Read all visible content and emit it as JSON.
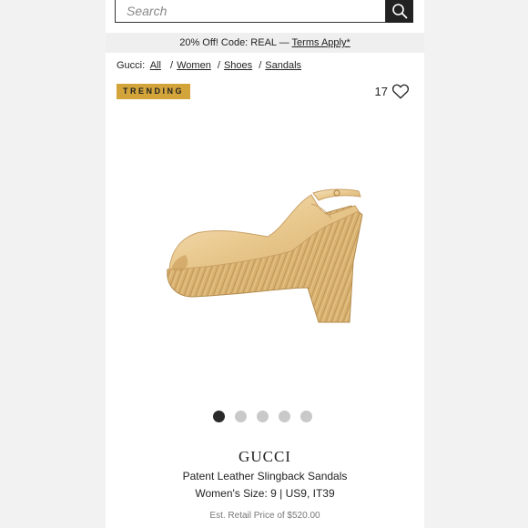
{
  "search": {
    "placeholder": "Search",
    "icon": "search-icon"
  },
  "promo": {
    "text": "20% Off! Code: REAL —",
    "link": "Terms Apply*"
  },
  "breadcrumb": {
    "prefix": "Gucci:",
    "items": [
      "All",
      "Women",
      "Shoes",
      "Sandals"
    ]
  },
  "badge": {
    "label": "TRENDING",
    "color": "#d3a43a"
  },
  "likes": {
    "count": "17",
    "icon": "heart-outline-icon"
  },
  "carousel": {
    "total": 5,
    "active_index": 0
  },
  "product": {
    "brand": "GUCCI",
    "title": "Patent Leather Slingback Sandals",
    "size": "Women's Size: 9 | US9, IT39",
    "retail_price": "Est. Retail Price of $520.00"
  }
}
